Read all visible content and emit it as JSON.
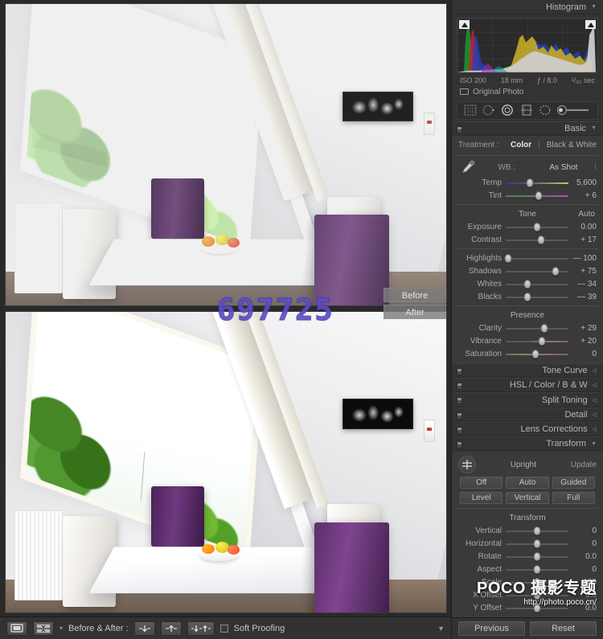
{
  "app": {
    "module": "Develop"
  },
  "histogram": {
    "title": "Histogram",
    "collapse_icon": "triangle-down-icon",
    "clip_shadow_icon": "shadow-clipping-triangle-icon",
    "clip_highlight_icon": "highlight-clipping-triangle-icon",
    "meta": {
      "iso": "ISO 200",
      "focal": "18 mm",
      "aperture": "ƒ / 8.0",
      "shutter": "¹/₃₀ sec"
    },
    "original_photo_label": "Original Photo",
    "original_photo_icon": "rectangle-outline-icon"
  },
  "toolstrip": {
    "tools": [
      {
        "name": "crop-overlay-tool",
        "icon": "crop-grid-icon"
      },
      {
        "name": "spot-removal-tool",
        "icon": "circle-arrow-icon"
      },
      {
        "name": "red-eye-correction-tool",
        "icon": "filled-eye-circle-icon"
      },
      {
        "name": "graduated-filter-tool",
        "icon": "rectangle-gradient-icon"
      },
      {
        "name": "radial-filter-tool",
        "icon": "ellipse-icon"
      },
      {
        "name": "adjustment-brush-tool",
        "icon": "brush-slider-icon"
      }
    ]
  },
  "basic": {
    "title": "Basic",
    "treatment_label": "Treatment :",
    "treatment_options": [
      "Color",
      "Black & White"
    ],
    "treatment_selected": "Color",
    "wb_label": "WB :",
    "wb_value": "As Shot",
    "wb_caret": "⁞",
    "eyedropper_icon": "eyedropper-icon",
    "wb_sliders": [
      {
        "label": "Temp",
        "value": "5,600",
        "pos": 38,
        "track": "temp"
      },
      {
        "label": "Tint",
        "value": "+ 6",
        "pos": 52,
        "track": "tint"
      }
    ],
    "tone_title": "Tone",
    "tone_auto": "Auto",
    "tone_sliders": [
      {
        "label": "Exposure",
        "value": "0.00",
        "pos": 50,
        "track": ""
      },
      {
        "label": "Contrast",
        "value": "+ 17",
        "pos": 57,
        "track": ""
      },
      {
        "label": "Highlights",
        "value": "— 100",
        "pos": 4,
        "track": ""
      },
      {
        "label": "Shadows",
        "value": "+ 75",
        "pos": 80,
        "track": ""
      },
      {
        "label": "Whites",
        "value": "— 34",
        "pos": 35,
        "track": ""
      },
      {
        "label": "Blacks",
        "value": "— 39",
        "pos": 34,
        "track": ""
      }
    ],
    "presence_title": "Presence",
    "presence_sliders": [
      {
        "label": "Clarity",
        "value": "+ 29",
        "pos": 62,
        "track": ""
      },
      {
        "label": "Vibrance",
        "value": "+ 20",
        "pos": 58,
        "track": "vib"
      },
      {
        "label": "Saturation",
        "value": "0",
        "pos": 48,
        "track": "sat"
      }
    ]
  },
  "sections": [
    {
      "title": "Tone Curve",
      "state": "collapsed"
    },
    {
      "title": "HSL / Color / B & W",
      "state": "collapsed"
    },
    {
      "title": "Split Toning",
      "state": "collapsed"
    },
    {
      "title": "Detail",
      "state": "collapsed"
    },
    {
      "title": "Lens Corrections",
      "state": "collapsed"
    }
  ],
  "transform": {
    "title": "Transform",
    "upright_label": "Upright",
    "update_label": "Update",
    "upright_icon": "transform-crosshair-icon",
    "buttons_row1": [
      "Off",
      "Auto",
      "Guided"
    ],
    "buttons_row2": [
      "Level",
      "Vertical",
      "Full"
    ],
    "sub_title": "Transform",
    "sliders": [
      {
        "label": "Vertical",
        "value": "0",
        "pos": 50
      },
      {
        "label": "Horizontal",
        "value": "0",
        "pos": 50
      },
      {
        "label": "Rotate",
        "value": "0.0",
        "pos": 50
      },
      {
        "label": "Aspect",
        "value": "0",
        "pos": 50
      },
      {
        "label": "Scale",
        "value": "100",
        "pos": 50
      },
      {
        "label": "X Offset",
        "value": "0.0",
        "pos": 50
      },
      {
        "label": "Y Offset",
        "value": "0.0",
        "pos": 50
      }
    ]
  },
  "right_footer": {
    "previous_label": "Previous",
    "reset_label": "Reset"
  },
  "preview": {
    "before_label": "Before",
    "after_label": "After",
    "watermark": "697725"
  },
  "toolbar": {
    "view_loupe_icon": "loupe-view-icon",
    "view_beforeafter_icon": "before-after-split-icon",
    "caret_icon": "chevron-down-icon",
    "before_after_label": "Before & After :",
    "mode_buttons": [
      {
        "name": "before-after-left-right",
        "icon": "arrow-down-icon"
      },
      {
        "name": "before-after-top-bottom",
        "icon": "arrow-up-icon"
      },
      {
        "name": "before-after-split",
        "icon": "arrow-down-up-icon"
      }
    ],
    "soft_proofing_label": "Soft Proofing",
    "soft_proofing_checked": false,
    "collapse_icon": "chevron-down-icon"
  },
  "watermark_brand": {
    "name": "POCO 摄影专题",
    "url": "http://photo.poco.cn/"
  },
  "colors": {
    "panel_bg": "#333333",
    "section_bg": "#3a3a3a",
    "text": "#a9a9a9",
    "accent_watermark": "#5b4fc4"
  }
}
